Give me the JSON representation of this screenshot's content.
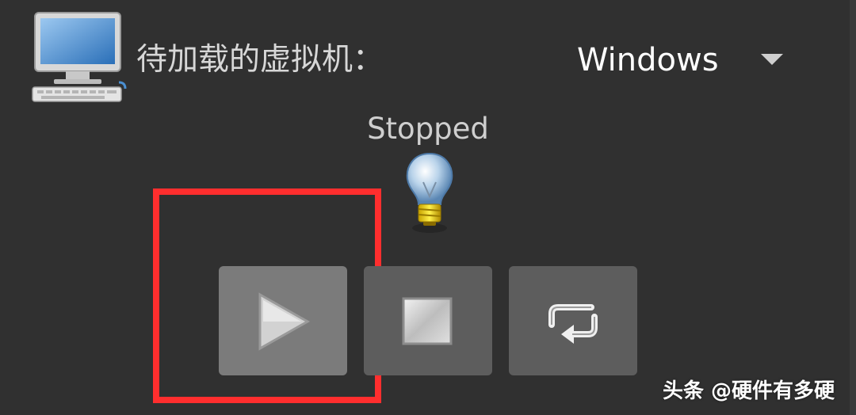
{
  "header": {
    "vm_label": "待加载的虚拟机：",
    "os_selected": "Windows"
  },
  "status": {
    "text": "Stopped"
  },
  "controls": {
    "buttons": [
      "play",
      "stop",
      "restart"
    ],
    "highlighted": "play"
  },
  "watermark": {
    "text": "头条 @硬件有多硬"
  },
  "colors": {
    "background": "#303030",
    "highlight": "#ff2e2e",
    "button": "#5d5d5d",
    "button_active": "#7b7b7b"
  },
  "icons": [
    "computer-icon",
    "dropdown-arrow-icon",
    "lightbulb-icon",
    "play-icon",
    "stop-icon",
    "restart-icon"
  ]
}
